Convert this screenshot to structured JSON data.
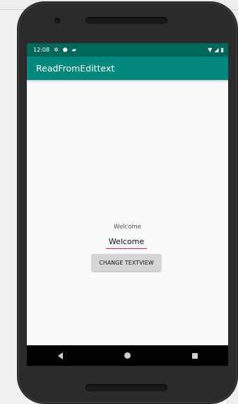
{
  "status_bar": {
    "time": "12:08",
    "left_icons": [
      "gear-icon",
      "shield-icon",
      "sd-card-icon"
    ],
    "right_icons": [
      "wifi-icon",
      "signal-icon",
      "battery-icon"
    ]
  },
  "app": {
    "title": "ReadFromEdittext",
    "accent": "#00897b",
    "status_color": "#00675b"
  },
  "content": {
    "label_text": "Welcome",
    "edit_value": "Welcome",
    "button_label": "CHANGE TEXTVIEW",
    "edit_underline": "#d81b60"
  },
  "navigation": {
    "back": "back-icon",
    "home": "home-icon",
    "recents": "recents-icon"
  }
}
